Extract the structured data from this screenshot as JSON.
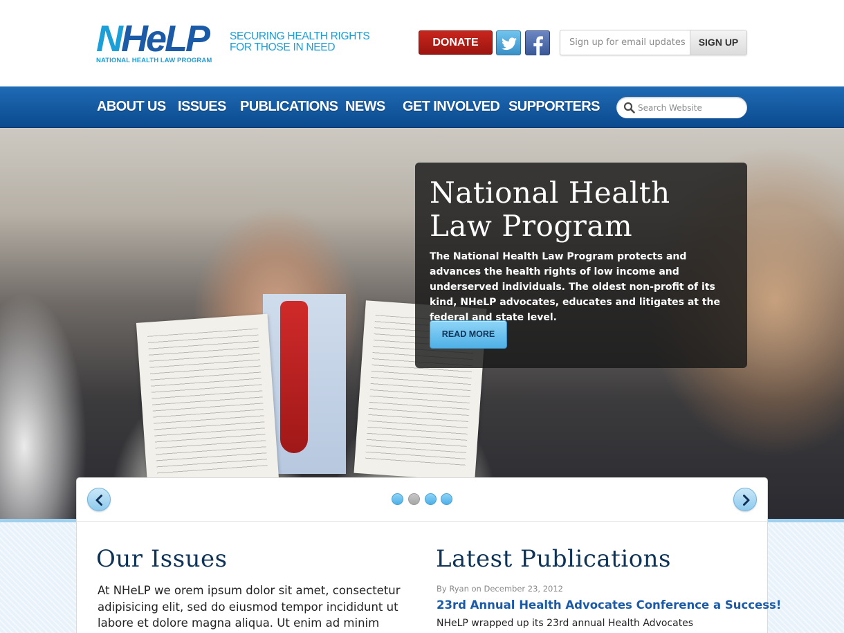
{
  "header": {
    "logo_text": "NHeLP",
    "logo_subtitle": "NATIONAL HEALTH LAW PROGRAM",
    "tagline_line1": "SECURING HEALTH RIGHTS",
    "tagline_line2": "FOR THOSE IN NEED",
    "donate_label": "DONATE",
    "social": [
      {
        "name": "twitter",
        "icon": "twitter-icon"
      },
      {
        "name": "facebook",
        "icon": "facebook-icon"
      }
    ],
    "email_placeholder": "Sign up for email updates",
    "signup_label": "SIGN UP"
  },
  "nav": {
    "items": [
      "ABOUT US",
      "ISSUES",
      "PUBLICATIONS",
      "NEWS",
      "GET INVOLVED",
      "SUPPORTERS"
    ],
    "search_placeholder": "Search Website",
    "search_icon": "magnifier-icon"
  },
  "hero": {
    "title": "National Health Law Program",
    "text": "The National Health Law Program protects and advances the health rights of low income and underserved individuals. The oldest non-profit of its kind, NHeLP advocates, educates and litigates at the federal and state level.",
    "button_label": "READ MORE",
    "slides": {
      "count": 4,
      "active_index": 1
    }
  },
  "issues": {
    "title": "Our Issues",
    "text": "At NHeLP we orem ipsum dolor sit amet, consectetur adipisicing elit, sed do eiusmod tempor incididunt ut labore et dolore magna aliqua. Ut enim ad minim veniam,"
  },
  "publications": {
    "title": "Latest Publications",
    "items": [
      {
        "meta": "By Ryan on December 23, 2012",
        "title": "23rd Annual Health Advocates Conference a Success!",
        "excerpt": "NHeLP wrapped up its 23rd annual Health Advocates Conference in"
      }
    ]
  },
  "colors": {
    "brand_blue": "#1a5aa6",
    "accent_light_blue": "#1a9fd9",
    "donate_red": "#b01e17",
    "nav_blue": "#145aa0"
  }
}
